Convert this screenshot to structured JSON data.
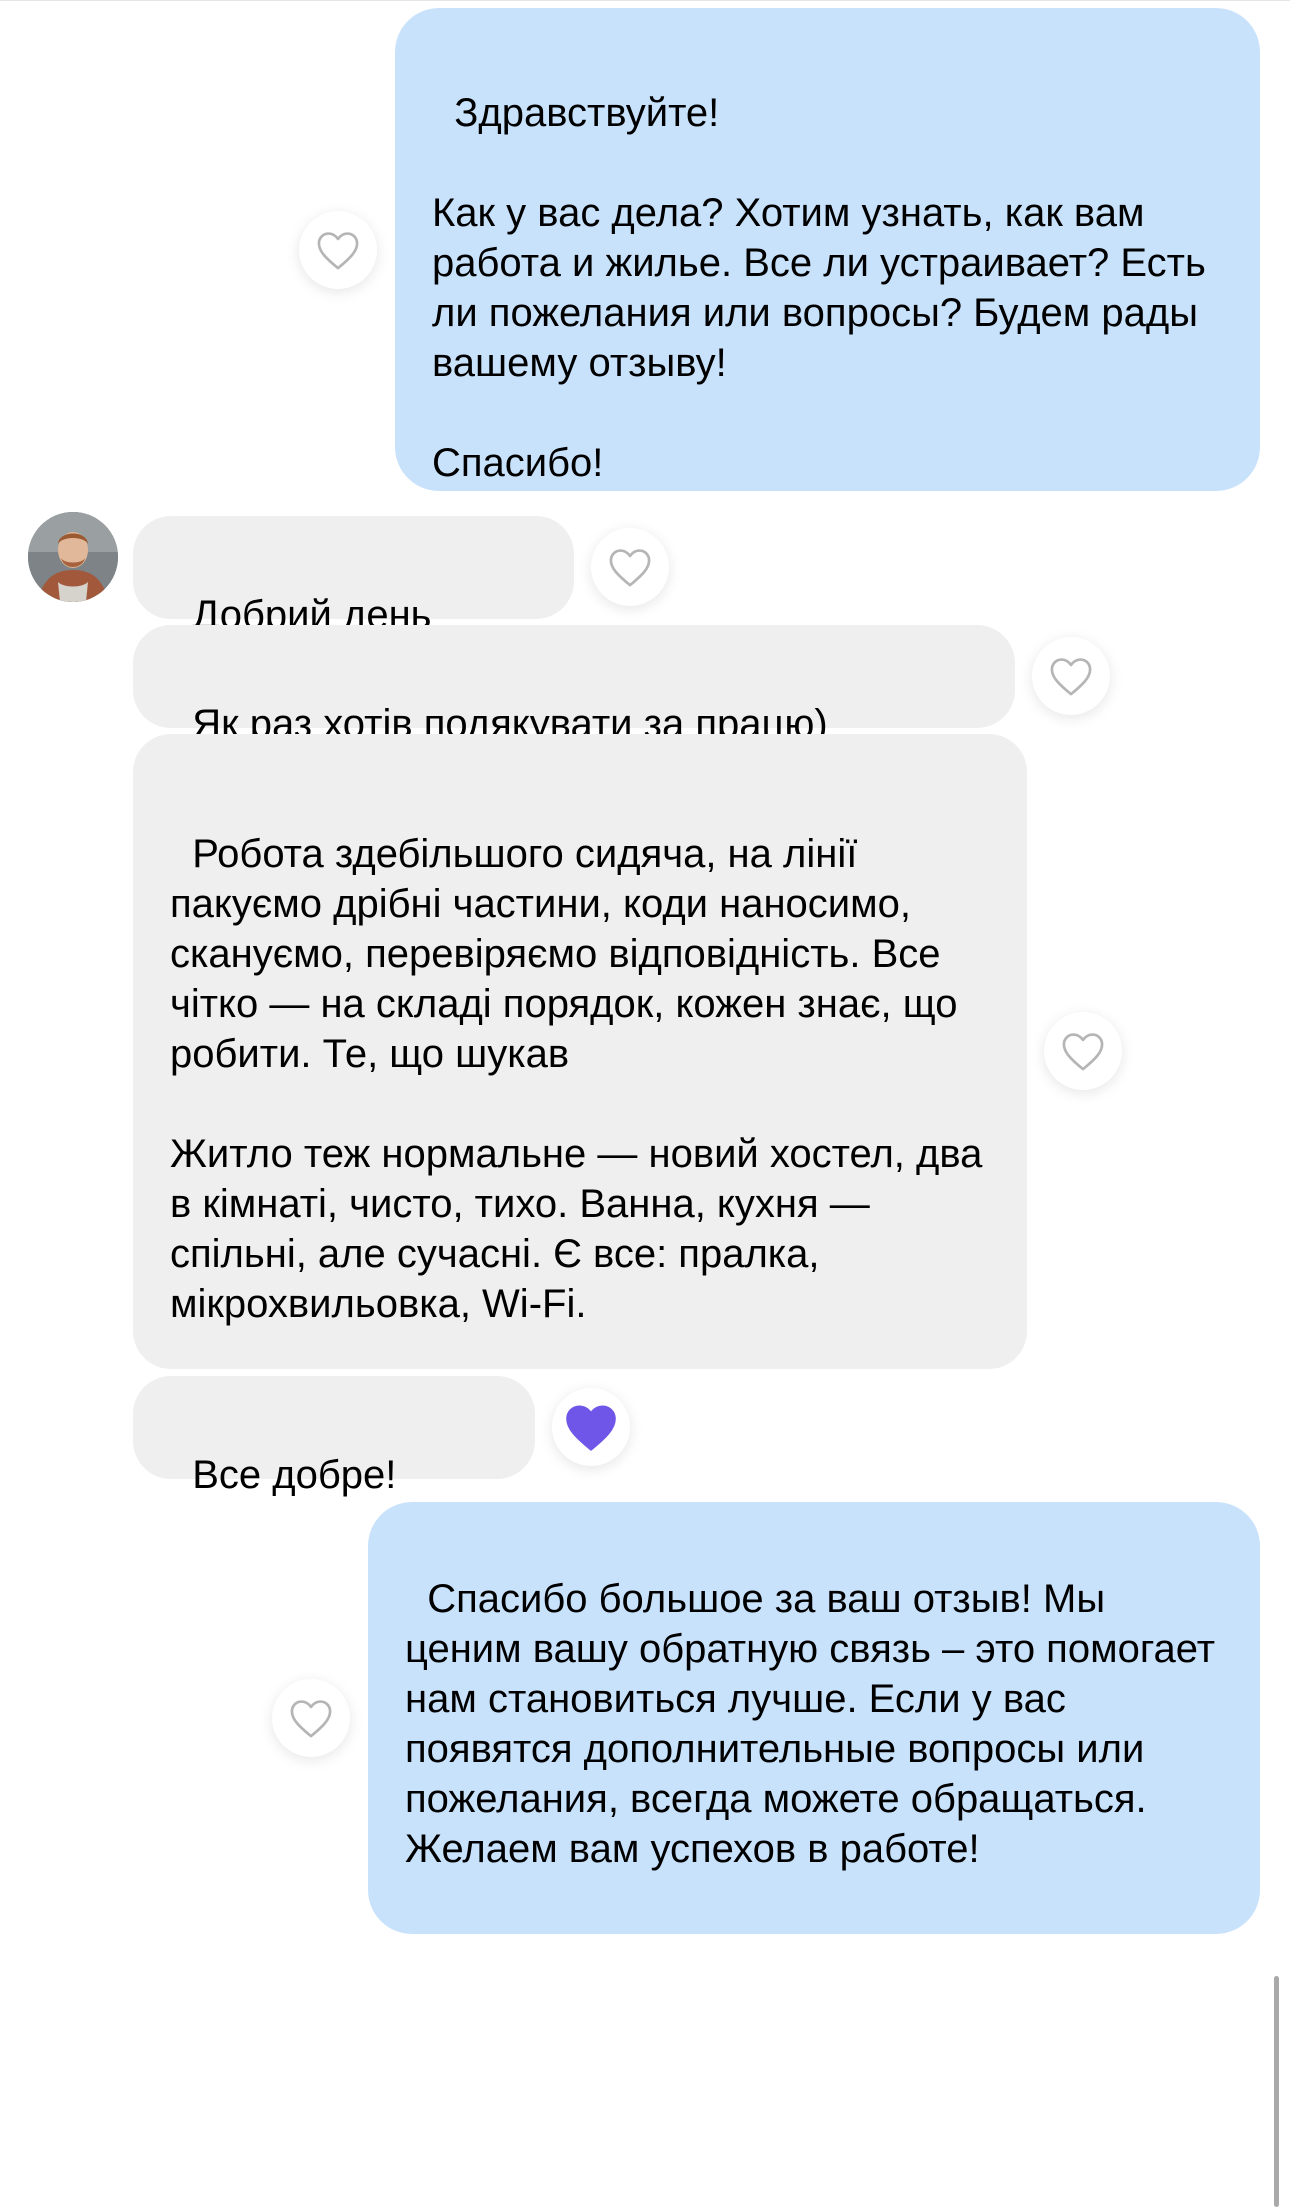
{
  "messages": {
    "m1": {
      "text": "Здравствуйте!\n\nКак у вас дела? Хотим узнать, как вам работа и жилье. Все ли устраивает? Есть ли пожелания или вопросы? Будем рады вашему отзыву!\n\nСпасибо!"
    },
    "m2": {
      "text": "Добрий день"
    },
    "m3": {
      "text": "Як раз хотів подякувати за працю)"
    },
    "m4": {
      "text": "Робота здебільшого сидяча, на лінії пакуємо дрібні частини, коди наносимо, скануємо, перевіряємо відповідність. Все чітко — на складі порядок, кожен знає, що робити. Те, що шукав\n\nЖитло теж нормальне — новий хостел, два в кімнаті, чисто, тихо. Ванна, кухня — спільні, але сучасні. Є все: пралка, мікрохвильовка, Wi-Fi."
    },
    "m5": {
      "text": "Все добре!"
    },
    "m6": {
      "text": "Спасибо большое за ваш отзыв! Мы ценим вашу обратную связь – это помогает нам становиться лучше. Если у вас появятся дополнительные вопросы или пожелания, всегда можете обращаться. Желаем вам успехов в работе!"
    }
  },
  "icons": {
    "like_outline": "heart-outline-icon",
    "like_filled": "heart-filled-icon"
  },
  "colors": {
    "outgoing_bubble": "#c9e2fc",
    "incoming_bubble": "#efefef",
    "heart_outline": "#b5b5b5",
    "heart_filled": "#7056e8"
  }
}
